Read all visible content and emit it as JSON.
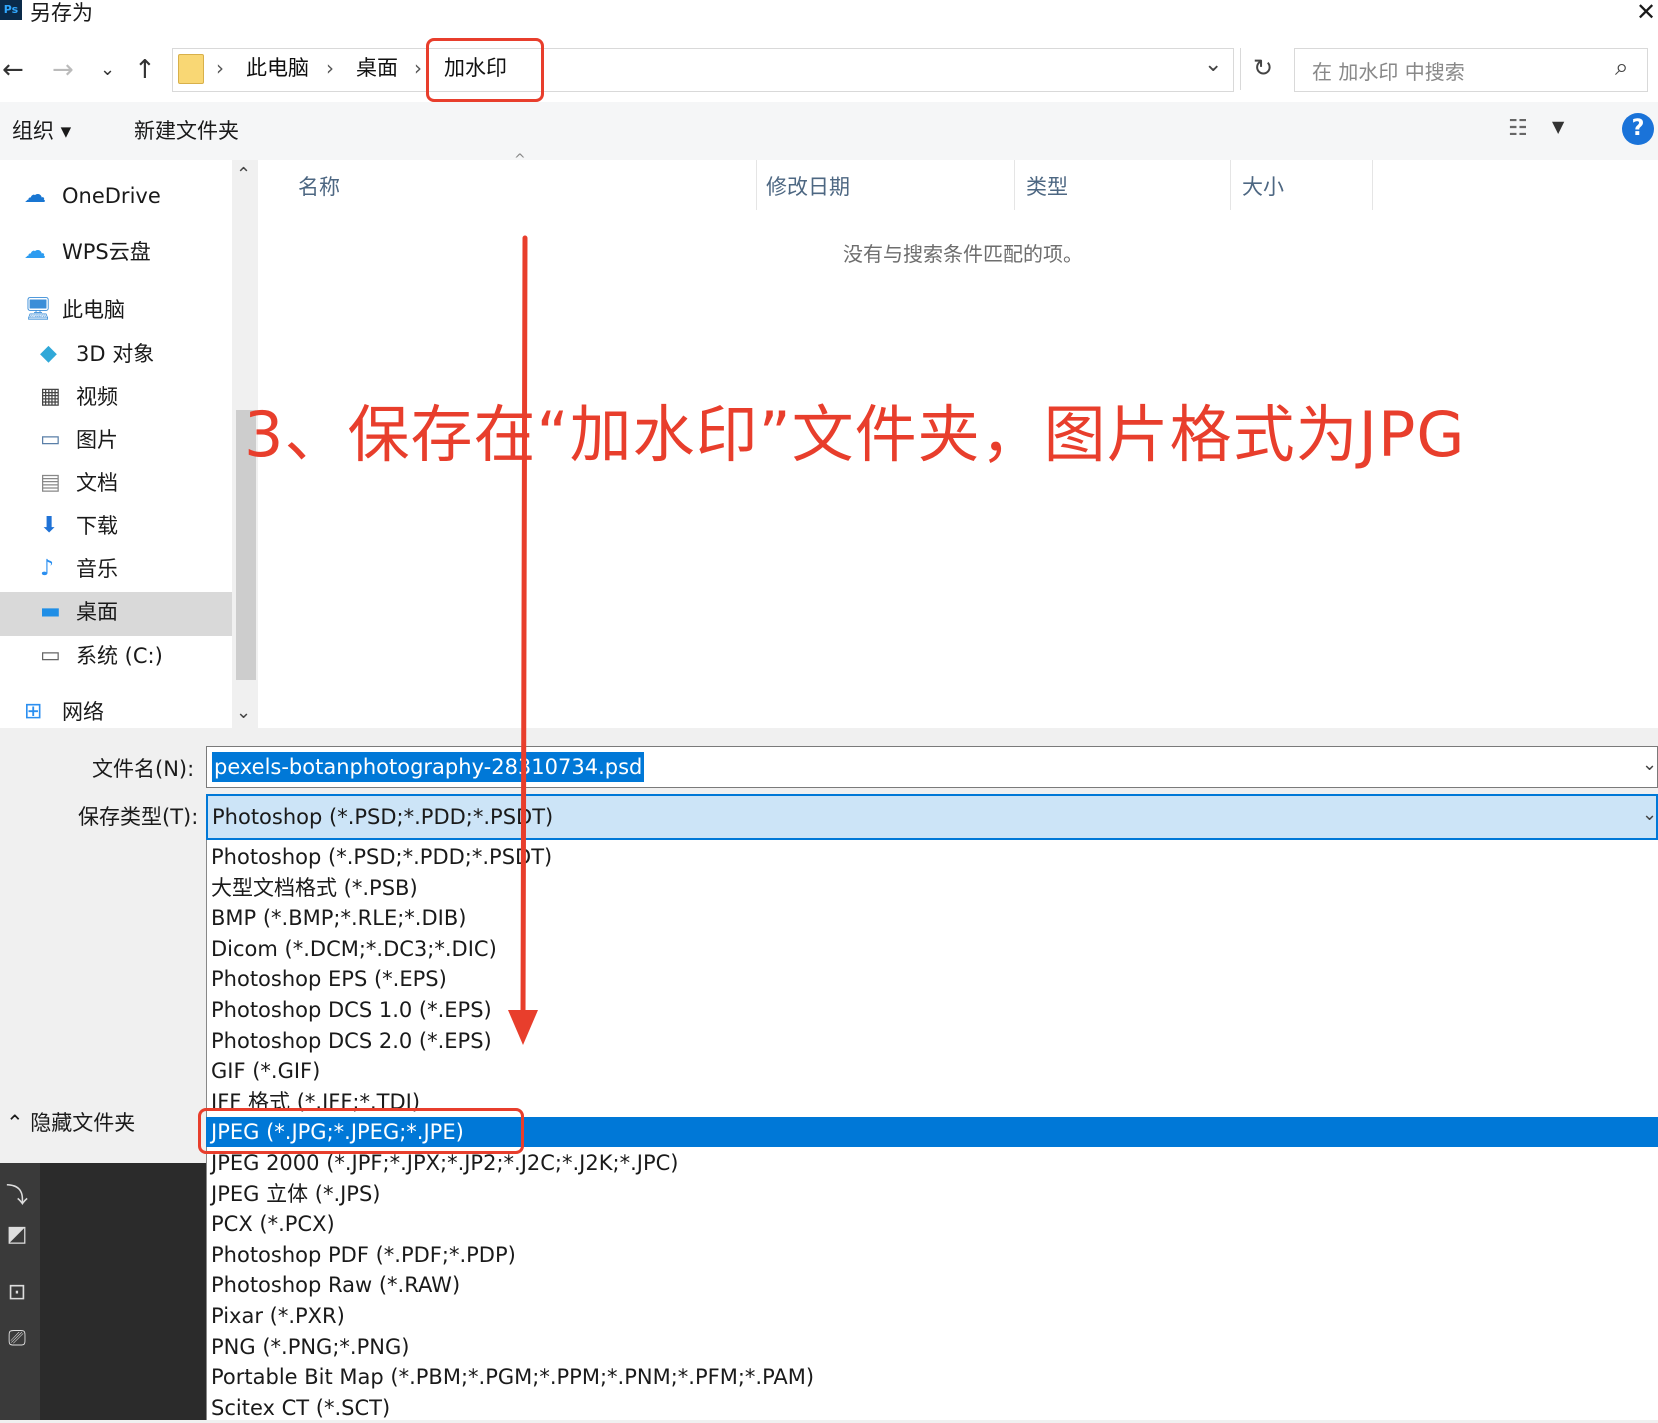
{
  "window": {
    "title": "另存为",
    "app_badge": "Ps",
    "close_glyph": "✕"
  },
  "nav": {
    "back": "←",
    "forward": "→",
    "recent": "⌄",
    "up": "↑",
    "breadcrumb": [
      "此电脑",
      "桌面",
      "加水印"
    ],
    "separator": "›",
    "dropdown_glyph": "⌄",
    "refresh": "↻",
    "search_placeholder": "在 加水印 中搜索",
    "search_icon": "⌕"
  },
  "toolbar": {
    "organize": "组织 ▾",
    "new_folder": "新建文件夹",
    "view_icon": "☷",
    "view_dropdown": "▼",
    "help": "?"
  },
  "sidebar": {
    "items": [
      {
        "label": "OneDrive",
        "icon": "cloud-icon",
        "color": "#1976d2"
      },
      {
        "label": "WPS云盘",
        "icon": "cloud-icon",
        "color": "#2d9cf0"
      },
      {
        "label": "此电脑",
        "icon": "computer-icon",
        "color": "#3b8ed8"
      },
      {
        "label": "3D 对象",
        "icon": "cube-icon",
        "color": "#30a8d8"
      },
      {
        "label": "视频",
        "icon": "film-icon",
        "color": "#444"
      },
      {
        "label": "图片",
        "icon": "picture-icon",
        "color": "#5a7fa8"
      },
      {
        "label": "文档",
        "icon": "document-icon",
        "color": "#888"
      },
      {
        "label": "下载",
        "icon": "download-icon",
        "color": "#1f72d6"
      },
      {
        "label": "音乐",
        "icon": "music-icon",
        "color": "#2b8ff0"
      },
      {
        "label": "桌面",
        "icon": "desktop-icon",
        "color": "#1f8ee6",
        "selected": true
      },
      {
        "label": "系统 (C:)",
        "icon": "drive-icon",
        "color": "#666"
      },
      {
        "label": "网络",
        "icon": "network-icon",
        "color": "#2b8ff0"
      }
    ],
    "scroll_up": "⌃",
    "scroll_down": "⌄"
  },
  "filelist": {
    "columns": [
      "名称",
      "修改日期",
      "类型",
      "大小"
    ],
    "sort_glyph": "^",
    "empty_message": "没有与搜索条件匹配的项。"
  },
  "annotation": {
    "text": "3、保存在“加水印”文件夹，图片格式为JPG",
    "color": "#e83e2c"
  },
  "form": {
    "filename_label": "文件名(N):",
    "filename_value": "pexels-botanphotography-28310734.psd",
    "filetype_label": "保存类型(T):",
    "filetype_value": "Photoshop (*.PSD;*.PDD;*.PSDT)",
    "dropdown_glyph": "⌄",
    "hide_folders": "⌃  隐藏文件夹"
  },
  "filetype_options": [
    "Photoshop (*.PSD;*.PDD;*.PSDT)",
    "大型文档格式 (*.PSB)",
    "BMP (*.BMP;*.RLE;*.DIB)",
    "Dicom (*.DCM;*.DC3;*.DIC)",
    "Photoshop EPS (*.EPS)",
    "Photoshop DCS 1.0 (*.EPS)",
    "Photoshop DCS 2.0 (*.EPS)",
    "GIF (*.GIF)",
    "IFF 格式 (*.IFF;*.TDI)",
    "JPEG (*.JPG;*.JPEG;*.JPE)",
    "JPEG 2000 (*.JPF;*.JPX;*.JP2;*.J2C;*.J2K;*.JPC)",
    "JPEG 立体 (*.JPS)",
    "PCX (*.PCX)",
    "Photoshop PDF (*.PDF;*.PDP)",
    "Photoshop Raw (*.RAW)",
    "Pixar (*.PXR)",
    "PNG (*.PNG;*.PNG)",
    "Portable Bit Map (*.PBM;*.PGM;*.PPM;*.PNM;*.PFM;*.PAM)",
    "Scitex CT (*.SCT)"
  ],
  "selected_filetype_index": 9,
  "ps_tools": [
    "⤵",
    "◩",
    "⊡",
    "⎚"
  ]
}
